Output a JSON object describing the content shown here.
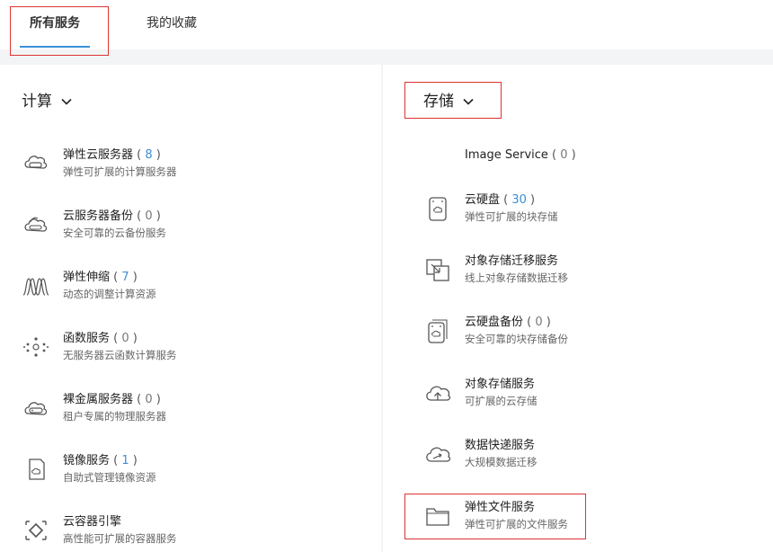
{
  "tabs": {
    "all_services": "所有服务",
    "favorites": "我的收藏"
  },
  "compute": {
    "title": "计算",
    "items": [
      {
        "name": "弹性云服务器",
        "count": "8",
        "desc": "弹性可扩展的计算服务器",
        "icon": "ecs-cloud-server-icon"
      },
      {
        "name": "云服务器备份",
        "count": "0",
        "desc": "安全可靠的云备份服务",
        "icon": "cloud-backup-icon"
      },
      {
        "name": "弹性伸缩",
        "count": "7",
        "desc": "动态的调整计算资源",
        "icon": "auto-scaling-icon"
      },
      {
        "name": "函数服务",
        "count": "0",
        "desc": "无服务器云函数计算服务",
        "icon": "function-service-icon"
      },
      {
        "name": "裸金属服务器",
        "count": "0",
        "desc": "租户专属的物理服务器",
        "icon": "bare-metal-server-icon"
      },
      {
        "name": "镜像服务",
        "count": "1",
        "desc": "自助式管理镜像资源",
        "icon": "image-service-icon"
      },
      {
        "name": "云容器引擎",
        "count": "",
        "desc": "高性能可扩展的容器服务",
        "icon": "container-engine-icon"
      }
    ]
  },
  "storage": {
    "title": "存储",
    "items": [
      {
        "name": "Image Service",
        "count": "0",
        "desc": "",
        "icon": ""
      },
      {
        "name": "云硬盘",
        "count": "30",
        "desc": "弹性可扩展的块存储",
        "icon": "cloud-disk-icon"
      },
      {
        "name": "对象存储迁移服务",
        "count": "",
        "desc": "线上对象存储数据迁移",
        "icon": "object-storage-migration-icon"
      },
      {
        "name": "云硬盘备份",
        "count": "0",
        "desc": "安全可靠的块存储备份",
        "icon": "disk-backup-icon"
      },
      {
        "name": "对象存储服务",
        "count": "",
        "desc": "可扩展的云存储",
        "icon": "object-storage-cloud-icon"
      },
      {
        "name": "数据快递服务",
        "count": "",
        "desc": "大规模数据迁移",
        "icon": "data-express-icon"
      },
      {
        "name": "弹性文件服务",
        "count": "",
        "desc": "弹性可扩展的文件服务",
        "icon": "folder-icon"
      }
    ]
  },
  "colors": {
    "accent": "#3b8fd6",
    "highlight_box": "#dd3333"
  }
}
